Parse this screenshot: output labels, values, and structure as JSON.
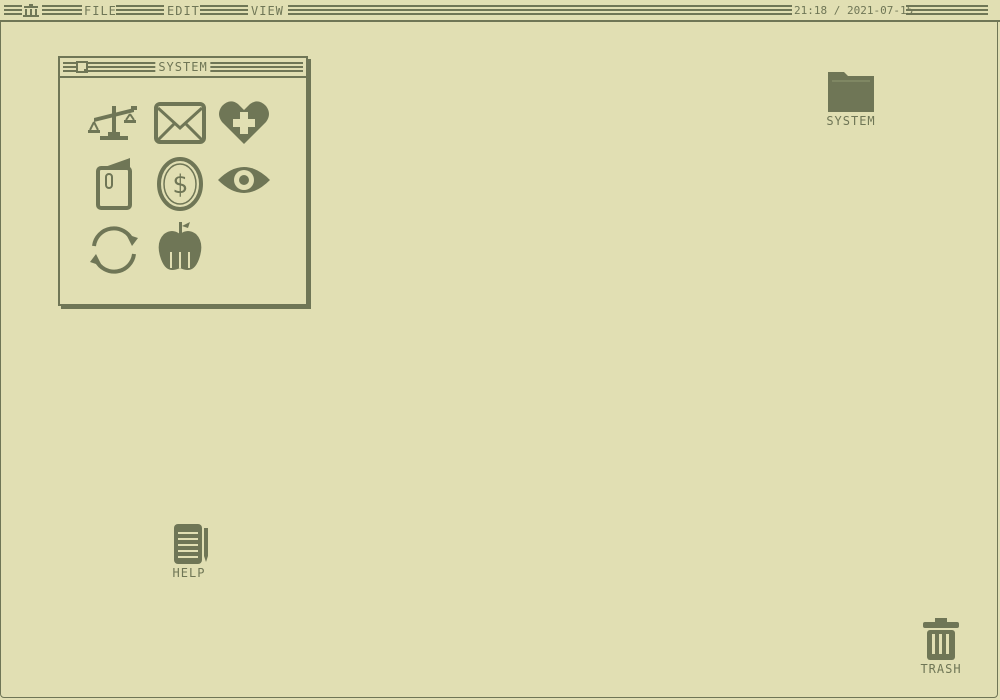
{
  "menubar": {
    "logo_icon": "bank-icon",
    "items": [
      {
        "label": "FILE"
      },
      {
        "label": "EDIT"
      },
      {
        "label": "VIEW"
      }
    ],
    "clock": "21:18 / 2021-07-15"
  },
  "window": {
    "title": "SYSTEM",
    "apps": [
      {
        "icon": "scales-icon"
      },
      {
        "icon": "mail-icon"
      },
      {
        "icon": "health-heart-icon"
      },
      {
        "icon": "notes-book-icon"
      },
      {
        "icon": "money-coin-icon"
      },
      {
        "icon": "eye-icon"
      },
      {
        "icon": "sync-icon"
      },
      {
        "icon": "apple-icon"
      }
    ]
  },
  "desktop": {
    "system_folder": {
      "label": "SYSTEM",
      "icon": "folder-icon"
    },
    "help": {
      "label": "HELP",
      "icon": "notepad-icon"
    },
    "trash": {
      "label": "TRASH",
      "icon": "trash-icon"
    }
  },
  "colors": {
    "background": "#e1dfb3",
    "ink": "#6f7656"
  }
}
